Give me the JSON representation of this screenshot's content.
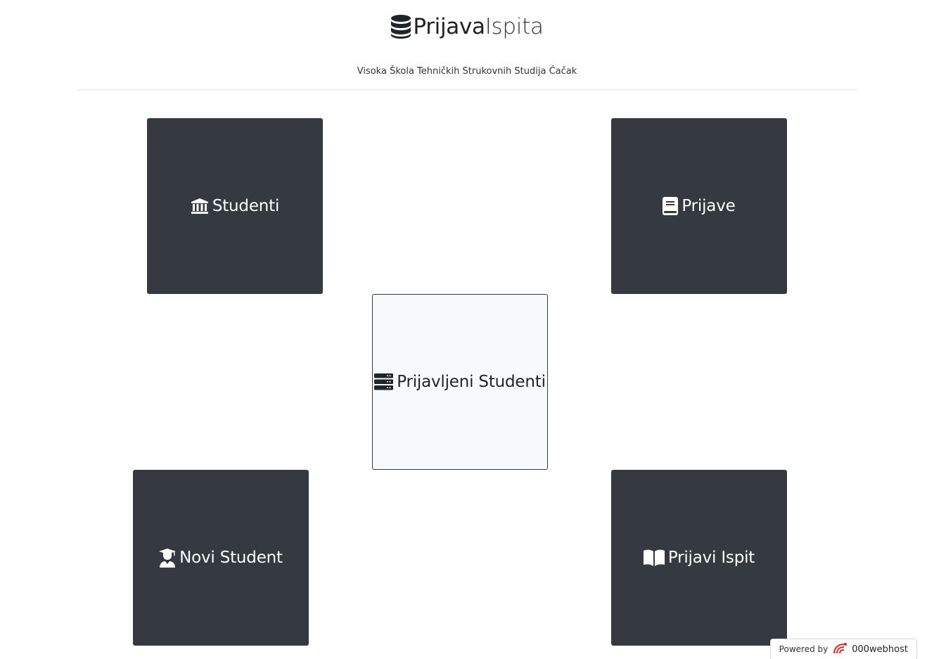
{
  "header": {
    "brand_strong": "Prijava",
    "brand_light": "Ispita",
    "brand_icon": "database-icon",
    "subtitle": "Visoka Škola Tehničkih Strukovnih Studija Čačak"
  },
  "tiles": [
    {
      "label": "Studenti",
      "icon": "university-icon",
      "style": "dark"
    },
    {
      "label": "Prijave",
      "icon": "book-icon",
      "style": "dark"
    },
    {
      "label": "Prijavljeni Studenti",
      "icon": "server-icon",
      "style": "light"
    },
    {
      "label": "Novi Student",
      "icon": "user-graduate-icon",
      "style": "dark"
    },
    {
      "label": "Prijavi Ispit",
      "icon": "book-open-icon",
      "style": "dark"
    }
  ],
  "footer": {
    "powered_by": "Powered by",
    "host_name": "000webhost"
  },
  "colors": {
    "dark_tile": "#343a40",
    "light_tile": "#f8f9fa",
    "host_accent": "#e2231a"
  }
}
